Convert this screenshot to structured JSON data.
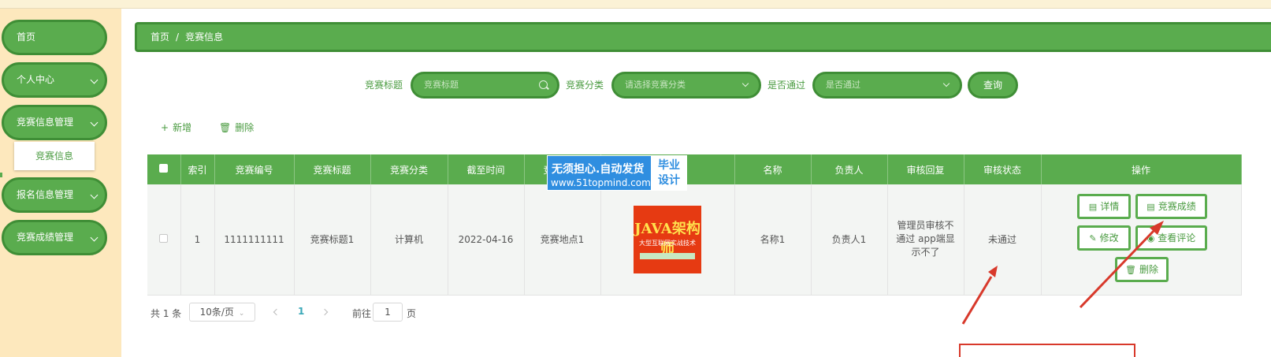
{
  "sidebar": {
    "items": [
      {
        "label": "首页"
      },
      {
        "label": "个人中心"
      },
      {
        "label": "竞赛信息管理"
      },
      {
        "label": "报名信息管理"
      },
      {
        "label": "竞赛成绩管理"
      }
    ],
    "submenu_label": "竞赛信息"
  },
  "breadcrumb": {
    "home": "首页",
    "separator": "/",
    "current": "竞赛信息"
  },
  "filters": {
    "title_label": "竞赛标题",
    "title_placeholder": "竞赛标题",
    "category_label": "竞赛分类",
    "category_placeholder": "请选择竞赛分类",
    "passed_label": "是否通过",
    "passed_placeholder": "是否通过",
    "query_label": "查询"
  },
  "toolbar": {
    "add_label": "新增",
    "delete_label": "删除"
  },
  "table": {
    "columns": [
      "索引",
      "竞赛编号",
      "竞赛标题",
      "竞赛分类",
      "截至时间",
      "竞赛地点",
      "竞赛图片",
      "名称",
      "负责人",
      "审核回复",
      "审核状态",
      "操作"
    ],
    "rows": [
      {
        "index": "1",
        "code": "1111111111",
        "title": "竞赛标题1",
        "category": "计算机",
        "deadline": "2022-04-16",
        "location": "竞赛地点1",
        "name": "名称1",
        "owner": "负责人1",
        "review_reply": "管理员审核不通过 app端显示不了",
        "review_status": "未通过"
      }
    ],
    "image": {
      "line1": "JAVA架构师",
      "line2": "大型互联网实战技术"
    },
    "actions": {
      "detail": "详情",
      "score": "竞赛成绩",
      "edit": "修改",
      "view_comment": "查看评论",
      "delete": "删除"
    }
  },
  "pagination": {
    "total": "共 1 条",
    "page_size": "10条/页",
    "current_page": "1",
    "goto_prefix": "前往",
    "goto_value": "1",
    "goto_suffix": "页"
  },
  "watermark": {
    "line1": "无须担心.自动发货",
    "line2": "www.51topmind.com",
    "badge_top": "毕业",
    "badge_bottom": "设计"
  },
  "colors": {
    "primary": "#5aac4e",
    "primary_dark": "#3f8e36",
    "sidebar_bg": "#fde8bd",
    "annotation": "#d8392b"
  }
}
